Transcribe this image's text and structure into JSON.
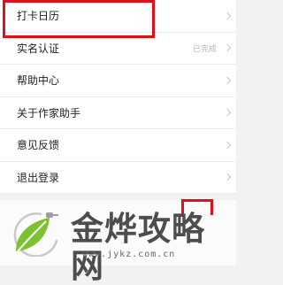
{
  "menu": {
    "items": [
      {
        "label": "打卡日历",
        "status": ""
      },
      {
        "label": "实名认证",
        "status": "已完成"
      },
      {
        "label": "帮助中心",
        "status": ""
      },
      {
        "label": "关于作家助手",
        "status": ""
      },
      {
        "label": "意见反馈",
        "status": ""
      },
      {
        "label": "退出登录",
        "status": ""
      }
    ]
  },
  "watermark": {
    "title": "金烨攻略网",
    "url": "www.jykz.com.cn"
  },
  "colors": {
    "highlight": "#e01019",
    "logo_green": "#7cc230",
    "text": "#222222"
  }
}
